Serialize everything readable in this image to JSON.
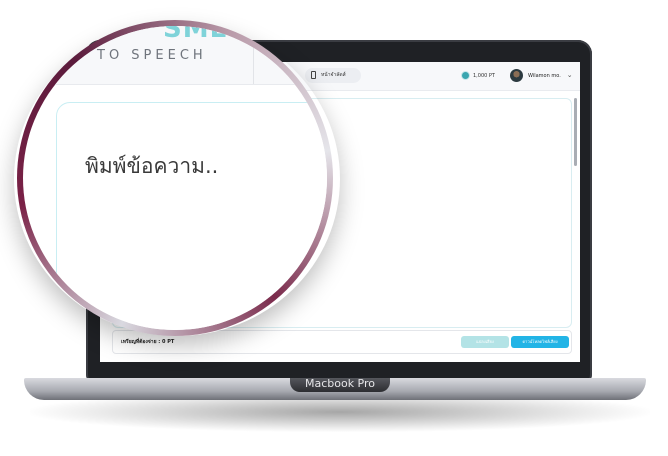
{
  "magnifier": {
    "logo_text": "SME",
    "subtitle": "TO SPEECH",
    "placeholder": "พิมพ์ข้อความ.."
  },
  "topbar": {
    "device_chip": "หน้าจำลัดส์",
    "points": "1,000 PT",
    "user_name": "Wilamon mo."
  },
  "footer": {
    "cost_label": "เหรียญที่ต้องจ่าย : 0 PT",
    "button_a_label": "แปลงเสียง",
    "button_b_label": "ดาวน์โหลดไฟล์เสียง"
  },
  "device": {
    "model_label": "Macbook Pro"
  },
  "colors": {
    "accent": "#22b4e6",
    "teal": "#7fd3d9",
    "ring": "#7a2146"
  }
}
